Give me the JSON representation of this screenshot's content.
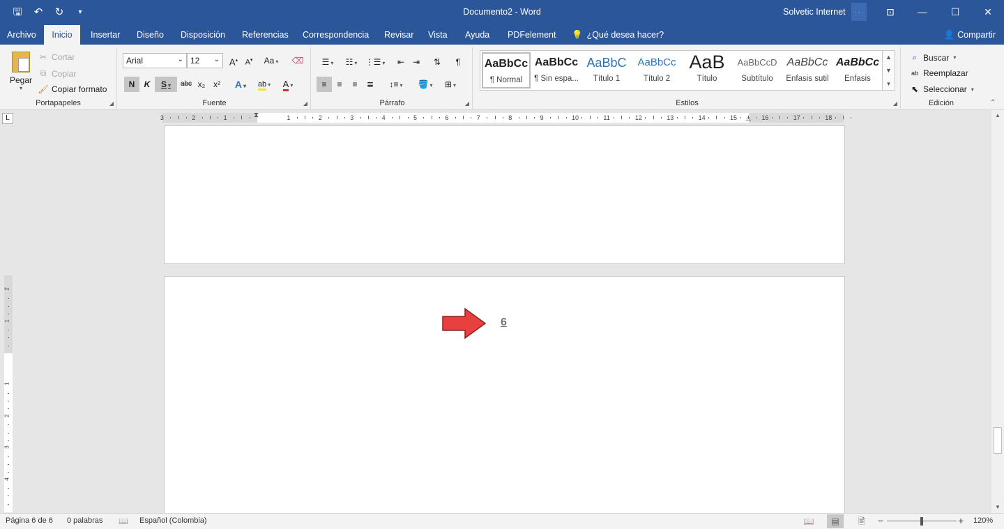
{
  "window": {
    "title": "Documento2 - Word",
    "user": "Solvetic Internet",
    "avatar_text": "· · ·",
    "qat_icons": [
      "save-icon",
      "undo-icon",
      "redo-icon",
      "customize-qat-icon"
    ],
    "controls": {
      "ribbon_display": "⊡",
      "minimize": "—",
      "maximize": "☐",
      "close": "✕"
    }
  },
  "tabs": [
    "Archivo",
    "Inicio",
    "Insertar",
    "Diseño",
    "Disposición",
    "Referencias",
    "Correspondencia",
    "Revisar",
    "Vista",
    "Ayuda",
    "PDFelement"
  ],
  "tell_me": "¿Qué desea hacer?",
  "share": "Compartir",
  "clipboard": {
    "label": "Portapapeles",
    "paste": "Pegar",
    "cut": "Cortar",
    "copy": "Copiar",
    "format_painter": "Copiar formato"
  },
  "font": {
    "label": "Fuente",
    "name": "Arial",
    "size": "12",
    "bold": "N",
    "italic": "K",
    "underline": "S",
    "strike": "abc",
    "subscript": "x₂",
    "superscript": "x²",
    "grow": "A",
    "shrink": "A",
    "change_case": "Aa",
    "highlight": "ab",
    "font_color": "A"
  },
  "paragraph": {
    "label": "Párrafo",
    "pilcrow": "¶"
  },
  "styles": {
    "label": "Estilos",
    "items": [
      {
        "sample": "AaBbCc",
        "name": "¶ Normal"
      },
      {
        "sample": "AaBbCc",
        "name": "¶ Sin espa..."
      },
      {
        "sample": "AaBbC",
        "name": "Título 1"
      },
      {
        "sample": "AaBbCc",
        "name": "Título 2"
      },
      {
        "sample": "AaB",
        "name": "Título"
      },
      {
        "sample": "AaBbCcD",
        "name": "Subtítulo"
      },
      {
        "sample": "AaBbCc",
        "name": "Énfasis sutil"
      },
      {
        "sample": "AaBbCc",
        "name": "Énfasis"
      }
    ]
  },
  "editing": {
    "label": "Edición",
    "find": "Buscar",
    "replace": "Reemplazar",
    "select": "Seleccionar"
  },
  "ruler": {
    "tab_selector": "L",
    "labels": [
      "3",
      "2",
      "1",
      "1",
      "2",
      "3",
      "4",
      "5",
      "6",
      "7",
      "8",
      "9",
      "10",
      "11",
      "12",
      "13",
      "14",
      "15",
      "16",
      "17",
      "18"
    ],
    "vertical_labels": [
      "2",
      "1",
      "1",
      "2",
      "3",
      "4"
    ]
  },
  "document": {
    "page_number": "6",
    "arrow_color": "#e8403f"
  },
  "status": {
    "page": "Página 6 de 6",
    "words": "0 palabras",
    "language": "Español (Colombia)",
    "zoom": "120%",
    "zoom_minus": "−",
    "zoom_plus": "+"
  },
  "colors": {
    "brand": "#2b579a",
    "ribbon": "#f3f3f3",
    "canvas": "#e6e6e6"
  }
}
